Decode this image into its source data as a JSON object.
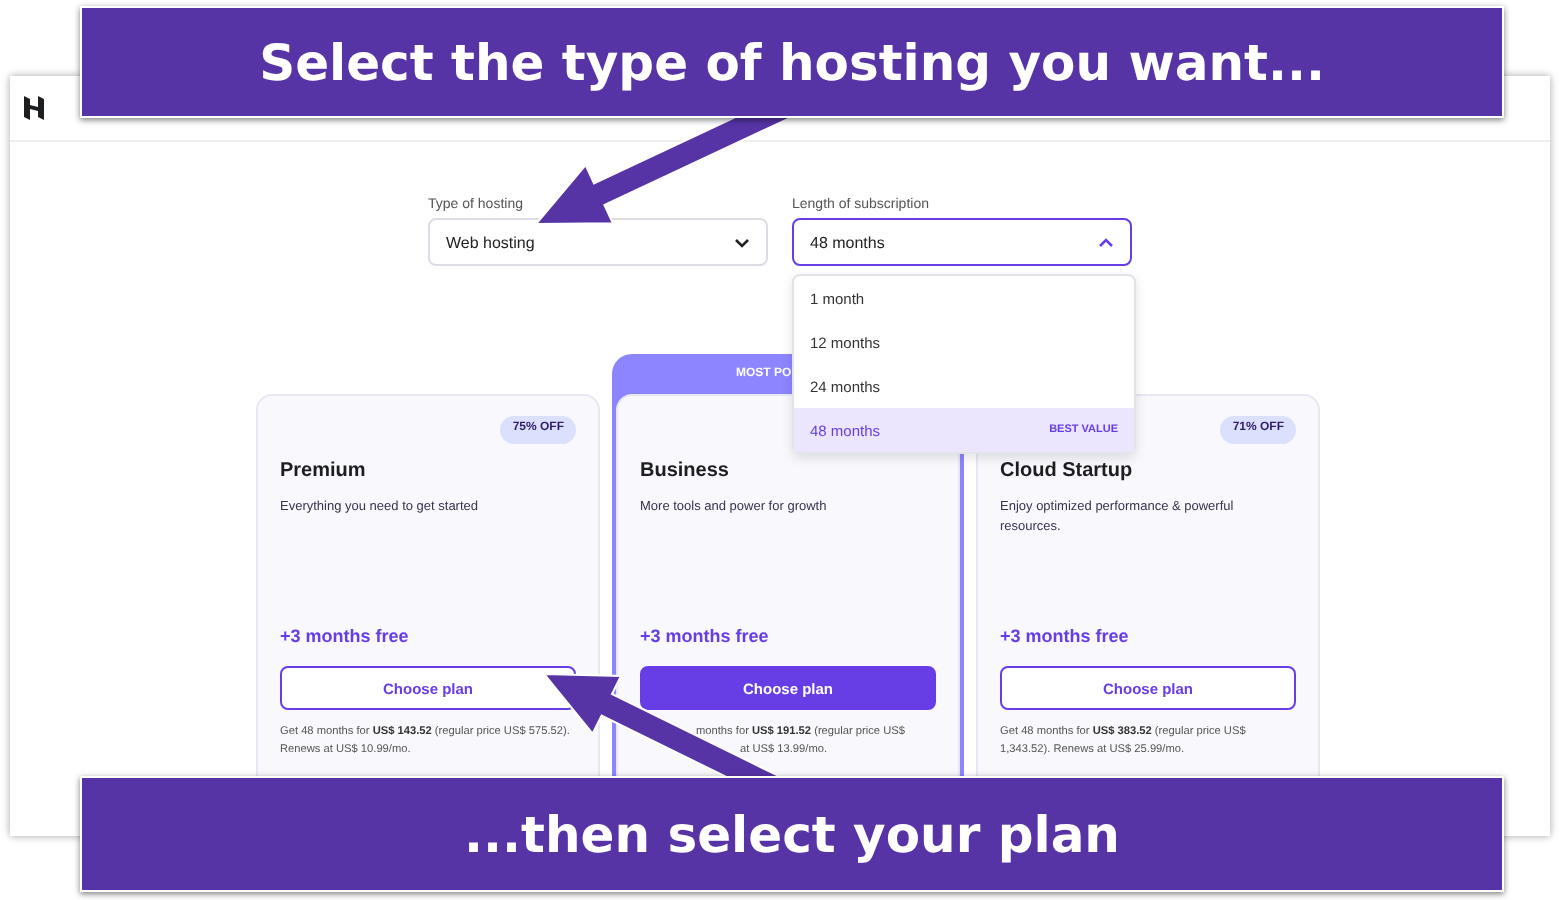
{
  "banners": [
    {
      "text": "Select the type of hosting you want..."
    },
    {
      "text": "...then select your plan"
    }
  ],
  "filters": [
    {
      "label": "Type of hosting",
      "value": "Web hosting",
      "expanded": false
    },
    {
      "label": "Length of subscription",
      "value": "48 months",
      "expanded": true
    }
  ],
  "dropdown_options": [
    {
      "label": "1 month",
      "selected": false
    },
    {
      "label": "12 months",
      "selected": false
    },
    {
      "label": "24 months",
      "selected": false
    },
    {
      "label": "48 months",
      "selected": true,
      "badge": "BEST VALUE"
    }
  ],
  "plans": [
    {
      "name": "Premium",
      "description": "Everything you need to get started",
      "discount": "75% OFF",
      "bonus": "+3 months free",
      "button": {
        "label": "Choose plan",
        "primary": false
      },
      "fine_print": "Get 48 months for **US$ 143.52** (regular price US$ 575.52). Renews at US$ 10.99/mo."
    },
    {
      "name": "Business",
      "popular_label": "MOST PO",
      "description": "More tools and power for growth",
      "bonus": "+3 months free",
      "button": {
        "label": "Choose plan",
        "primary": true
      },
      "fine_print": "months for **US$ 191.52** (regular price US$",
      "fine_print_tail": "at US$ 13.99/mo."
    },
    {
      "name": "Cloud Startup",
      "description": "Enjoy optimized performance & powerful resources.",
      "discount": "71% OFF",
      "bonus": "+3 months free",
      "button": {
        "label": "Choose plan",
        "primary": false
      },
      "fine_print": "Get 48 months for **US$ 383.52** (regular price US$ 1,343.52). Renews at US$ 25.99/mo."
    }
  ]
}
